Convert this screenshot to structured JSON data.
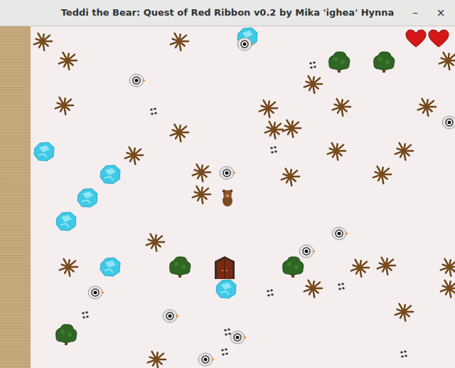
{
  "window": {
    "title": "Teddi the Bear: Quest of Red Ribbon v0.2 by Mika 'ighea' Hynna",
    "buttons": [
      "–",
      "×"
    ]
  },
  "hud": {
    "hearts": [
      {
        "full": true
      },
      {
        "full": true
      }
    ]
  },
  "entities": [
    {
      "kind": "dead-tree"
    },
    {
      "kind": "dead-tree"
    },
    {
      "kind": "dead-tree"
    },
    {
      "kind": "dead-tree"
    },
    {
      "kind": "dead-tree"
    },
    {
      "kind": "dead-tree"
    },
    {
      "kind": "dead-tree"
    },
    {
      "kind": "dead-tree"
    },
    {
      "kind": "dead-tree"
    },
    {
      "kind": "dead-tree"
    },
    {
      "kind": "dead-tree"
    },
    {
      "kind": "dead-tree"
    },
    {
      "kind": "dead-tree"
    },
    {
      "kind": "dead-tree"
    },
    {
      "kind": "dead-tree"
    },
    {
      "kind": "dead-tree"
    },
    {
      "kind": "dead-tree"
    },
    {
      "kind": "dead-tree"
    },
    {
      "kind": "dead-tree"
    },
    {
      "kind": "dead-tree"
    },
    {
      "kind": "dead-tree"
    },
    {
      "kind": "dead-tree"
    },
    {
      "kind": "dead-tree"
    },
    {
      "kind": "dead-tree"
    },
    {
      "kind": "dead-tree"
    },
    {
      "kind": "dead-tree"
    },
    {
      "kind": "dead-tree"
    },
    {
      "kind": "dead-tree"
    },
    {
      "kind": "bush"
    },
    {
      "kind": "bush"
    },
    {
      "kind": "bush"
    },
    {
      "kind": "bush"
    },
    {
      "kind": "bush"
    },
    {
      "kind": "ice"
    },
    {
      "kind": "ice"
    },
    {
      "kind": "ice"
    },
    {
      "kind": "ice"
    },
    {
      "kind": "ice"
    },
    {
      "kind": "ice"
    },
    {
      "kind": "ice"
    },
    {
      "kind": "critter"
    },
    {
      "kind": "critter"
    },
    {
      "kind": "critter"
    },
    {
      "kind": "critter"
    },
    {
      "kind": "critter"
    },
    {
      "kind": "critter"
    },
    {
      "kind": "critter"
    },
    {
      "kind": "critter"
    },
    {
      "kind": "critter"
    },
    {
      "kind": "critter"
    },
    {
      "kind": "tracks"
    },
    {
      "kind": "tracks"
    },
    {
      "kind": "tracks"
    },
    {
      "kind": "tracks"
    },
    {
      "kind": "tracks"
    },
    {
      "kind": "tracks"
    },
    {
      "kind": "tracks"
    },
    {
      "kind": "tracks"
    },
    {
      "kind": "tracks"
    },
    {
      "kind": "door"
    },
    {
      "kind": "bear"
    }
  ]
}
